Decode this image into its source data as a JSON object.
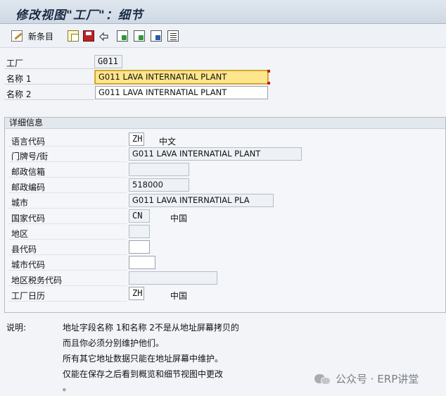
{
  "window": {
    "title": "修改视图\"工厂\"：细节"
  },
  "toolbar": {
    "new_entries_label": "新条目"
  },
  "header": {
    "plant_label": "工厂",
    "plant_value": "G011",
    "name1_label": "名称 1",
    "name1_value": "G011 LAVA INTERNATIAL PLANT",
    "name2_label": "名称 2",
    "name2_value": "G011 LAVA INTERNATIAL PLANT"
  },
  "details": {
    "group_title": "详细信息",
    "language_label": "语言代码",
    "language_value": "ZH",
    "language_text": "中文",
    "street_label": "门牌号/街",
    "street_value": "G011 LAVA INTERNATIAL PLANT",
    "pobox_label": "邮政信箱",
    "pobox_value": "",
    "postal_label": "邮政编码",
    "postal_value": "518000",
    "city_label": "城市",
    "city_value": "G011 LAVA INTERNATIAL PLA",
    "country_label": "国家代码",
    "country_value": "CN",
    "country_text": "中国",
    "region_label": "地区",
    "region_value": "",
    "county_label": "县代码",
    "county_value": "",
    "city_code_label": "城市代码",
    "city_code_value": "",
    "tax_label": "地区税务代码",
    "tax_value": "",
    "calendar_label": "工厂日历",
    "calendar_value": "ZH",
    "calendar_text": "中国"
  },
  "notes": {
    "label": "说明:",
    "line1": "地址字段名称 1和名称 2不是从地址屏幕拷贝的",
    "line2": "而且你必须分别维护他们。",
    "line3": "所有其它地址数据只能在地址屏幕中维护。",
    "line4": "仅能在保存之后看到概览和细节视图中更改",
    "line5": "。"
  },
  "watermark": {
    "text": "公众号 · ERP讲堂"
  },
  "colors": {
    "active_field": "#ffe68c",
    "title_bar": "#d5dee8",
    "required_mark": "#cc1a1a"
  }
}
